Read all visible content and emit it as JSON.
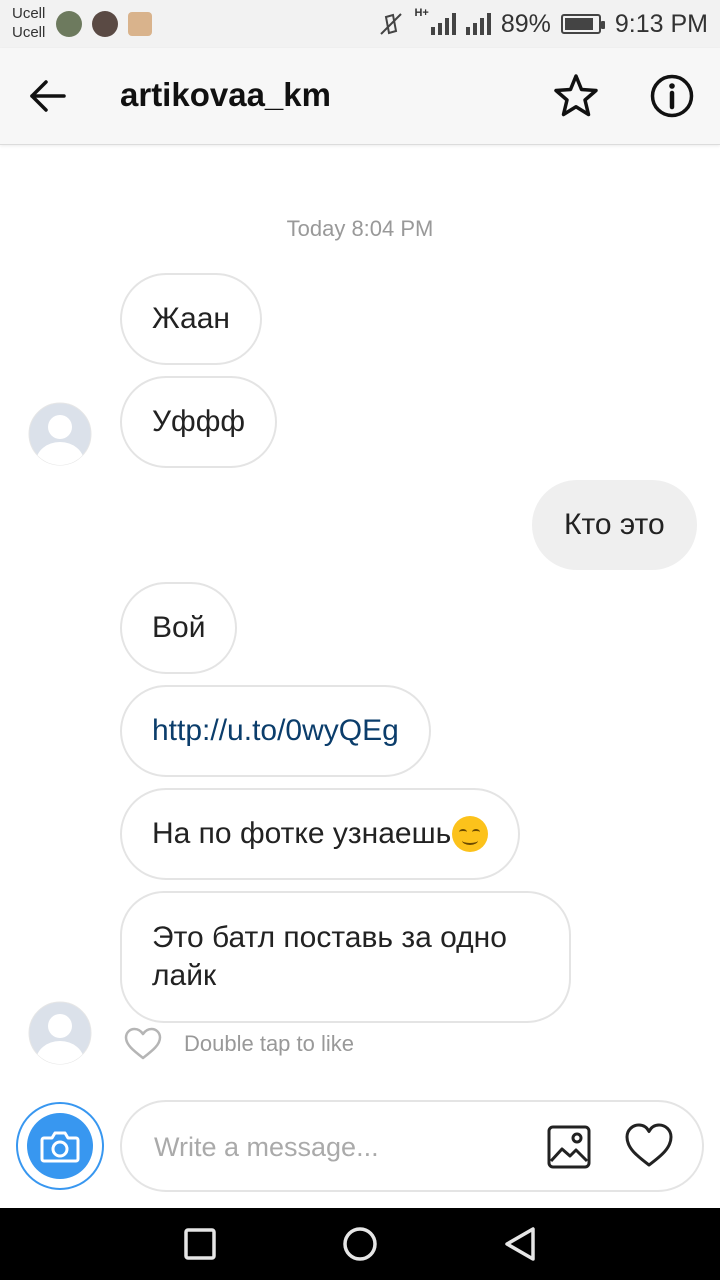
{
  "status_bar": {
    "carrier_1": "Ucell",
    "carrier_2": "Ucell",
    "network_type": "H+",
    "battery_percent": "89%",
    "battery_level": 0.89,
    "time": "9:13 PM"
  },
  "header": {
    "title": "artikovaa_km",
    "back_icon": "arrow-left-icon",
    "favorite_icon": "star-outline-icon",
    "info_icon": "info-circle-icon"
  },
  "conversation": {
    "timestamp": "Today 8:04 PM",
    "messages": [
      {
        "side": "incoming",
        "text": "Жаан"
      },
      {
        "side": "incoming",
        "text": "Уффф"
      },
      {
        "side": "outgoing",
        "text": "Кто это"
      },
      {
        "side": "incoming",
        "text": "Вой"
      },
      {
        "side": "incoming",
        "text": "http://u.to/0wyQEg",
        "is_link": true
      },
      {
        "side": "incoming",
        "text": "На по фотке узнаешь",
        "emoji": "smirking-face-emoji"
      },
      {
        "side": "incoming",
        "text_line_1": "Это батл поставь за одно",
        "text_line_2": "лайк"
      }
    ],
    "like_hint": "Double tap to like"
  },
  "composer": {
    "placeholder": "Write a message...",
    "camera_icon": "camera-icon",
    "gallery_icon": "image-icon",
    "like_icon": "heart-outline-icon"
  },
  "colors": {
    "accent": "#3897f0",
    "link": "#0b3d6b",
    "outgoing_bubble": "#efefef"
  }
}
